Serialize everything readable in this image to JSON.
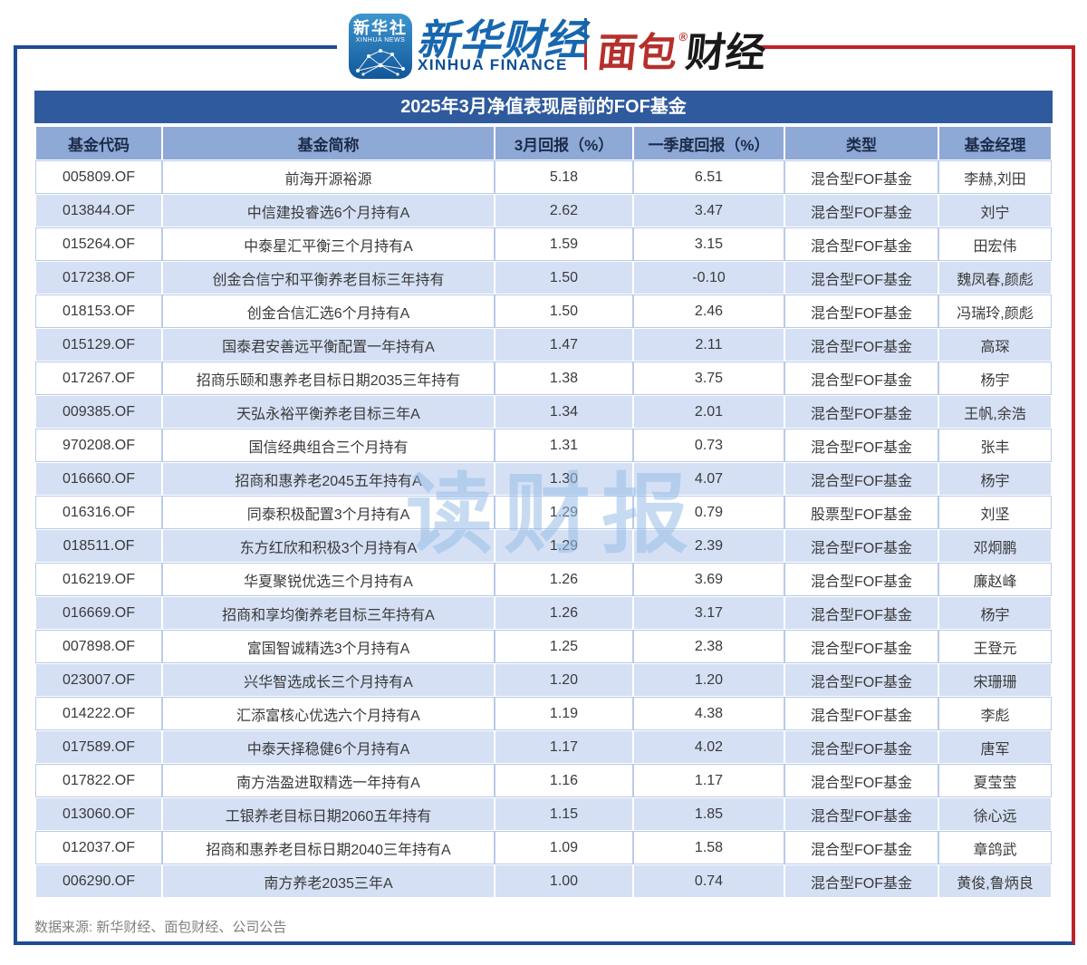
{
  "brand": {
    "xinhua_news_icon": {
      "line1": "新华社",
      "line2": "XINHUA NEWS"
    },
    "xinhua_finance": {
      "cn": "新华财经",
      "en": "XINHUA FINANCE"
    },
    "mianbao_finance": {
      "cn_red": "面包",
      "reg": "®",
      "cn_black": "财经"
    }
  },
  "colors": {
    "frame_blue": "#1E4C94",
    "frame_red": "#C02128",
    "title_bar": "#2F5A9D",
    "header_row": "#8FA9D6",
    "alt_row": "#D5E0F4",
    "watermark": "#97BDE7"
  },
  "watermark": "读财报",
  "footer": {
    "source": "数据来源: 新华财经、面包财经、公司公告"
  },
  "table": {
    "title": "2025年3月净值表现居前的FOF基金",
    "columns": [
      "基金代码",
      "基金简称",
      "3月回报（%）",
      "一季度回报（%）",
      "类型",
      "基金经理"
    ],
    "row_keys": [
      "code",
      "name",
      "march_return",
      "q1_return",
      "type",
      "manager"
    ],
    "rows": [
      {
        "code": "005809.OF",
        "name": "前海开源裕源",
        "march_return": "5.18",
        "q1_return": "6.51",
        "type": "混合型FOF基金",
        "manager": "李赫,刘田"
      },
      {
        "code": "013844.OF",
        "name": "中信建投睿选6个月持有A",
        "march_return": "2.62",
        "q1_return": "3.47",
        "type": "混合型FOF基金",
        "manager": "刘宁"
      },
      {
        "code": "015264.OF",
        "name": "中泰星汇平衡三个月持有A",
        "march_return": "1.59",
        "q1_return": "3.15",
        "type": "混合型FOF基金",
        "manager": "田宏伟"
      },
      {
        "code": "017238.OF",
        "name": "创金合信宁和平衡养老目标三年持有",
        "march_return": "1.50",
        "q1_return": "-0.10",
        "type": "混合型FOF基金",
        "manager": "魏凤春,颜彪"
      },
      {
        "code": "018153.OF",
        "name": "创金合信汇选6个月持有A",
        "march_return": "1.50",
        "q1_return": "2.46",
        "type": "混合型FOF基金",
        "manager": "冯瑞玲,颜彪"
      },
      {
        "code": "015129.OF",
        "name": "国泰君安善远平衡配置一年持有A",
        "march_return": "1.47",
        "q1_return": "2.11",
        "type": "混合型FOF基金",
        "manager": "高琛"
      },
      {
        "code": "017267.OF",
        "name": "招商乐颐和惠养老目标日期2035三年持有",
        "march_return": "1.38",
        "q1_return": "3.75",
        "type": "混合型FOF基金",
        "manager": "杨宇"
      },
      {
        "code": "009385.OF",
        "name": "天弘永裕平衡养老目标三年A",
        "march_return": "1.34",
        "q1_return": "2.01",
        "type": "混合型FOF基金",
        "manager": "王帆,余浩"
      },
      {
        "code": "970208.OF",
        "name": "国信经典组合三个月持有",
        "march_return": "1.31",
        "q1_return": "0.73",
        "type": "混合型FOF基金",
        "manager": "张丰"
      },
      {
        "code": "016660.OF",
        "name": "招商和惠养老2045五年持有A",
        "march_return": "1.30",
        "q1_return": "4.07",
        "type": "混合型FOF基金",
        "manager": "杨宇"
      },
      {
        "code": "016316.OF",
        "name": "同泰积极配置3个月持有A",
        "march_return": "1.29",
        "q1_return": "0.79",
        "type": "股票型FOF基金",
        "manager": "刘坚"
      },
      {
        "code": "018511.OF",
        "name": "东方红欣和积极3个月持有A",
        "march_return": "1.29",
        "q1_return": "2.39",
        "type": "混合型FOF基金",
        "manager": "邓炯鹏"
      },
      {
        "code": "016219.OF",
        "name": "华夏聚锐优选三个月持有A",
        "march_return": "1.26",
        "q1_return": "3.69",
        "type": "混合型FOF基金",
        "manager": "廉赵峰"
      },
      {
        "code": "016669.OF",
        "name": "招商和享均衡养老目标三年持有A",
        "march_return": "1.26",
        "q1_return": "3.17",
        "type": "混合型FOF基金",
        "manager": "杨宇"
      },
      {
        "code": "007898.OF",
        "name": "富国智诚精选3个月持有A",
        "march_return": "1.25",
        "q1_return": "2.38",
        "type": "混合型FOF基金",
        "manager": "王登元"
      },
      {
        "code": "023007.OF",
        "name": "兴华智选成长三个月持有A",
        "march_return": "1.20",
        "q1_return": "1.20",
        "type": "混合型FOF基金",
        "manager": "宋珊珊"
      },
      {
        "code": "014222.OF",
        "name": "汇添富核心优选六个月持有A",
        "march_return": "1.19",
        "q1_return": "4.38",
        "type": "混合型FOF基金",
        "manager": "李彪"
      },
      {
        "code": "017589.OF",
        "name": "中泰天择稳健6个月持有A",
        "march_return": "1.17",
        "q1_return": "4.02",
        "type": "混合型FOF基金",
        "manager": "唐军"
      },
      {
        "code": "017822.OF",
        "name": "南方浩盈进取精选一年持有A",
        "march_return": "1.16",
        "q1_return": "1.17",
        "type": "混合型FOF基金",
        "manager": "夏莹莹"
      },
      {
        "code": "013060.OF",
        "name": "工银养老目标日期2060五年持有",
        "march_return": "1.15",
        "q1_return": "1.85",
        "type": "混合型FOF基金",
        "manager": "徐心远"
      },
      {
        "code": "012037.OF",
        "name": "招商和惠养老目标日期2040三年持有A",
        "march_return": "1.09",
        "q1_return": "1.58",
        "type": "混合型FOF基金",
        "manager": "章鸽武"
      },
      {
        "code": "006290.OF",
        "name": "南方养老2035三年A",
        "march_return": "1.00",
        "q1_return": "0.74",
        "type": "混合型FOF基金",
        "manager": "黄俊,鲁炳良"
      }
    ]
  }
}
